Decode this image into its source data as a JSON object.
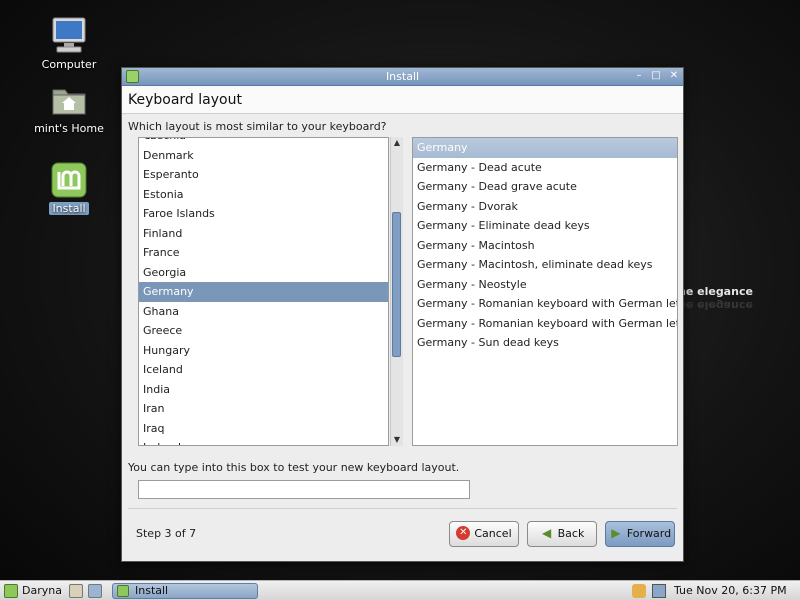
{
  "desktop": {
    "icons": [
      {
        "label": "Computer"
      },
      {
        "label": "mint's Home"
      },
      {
        "label": "Install"
      }
    ],
    "backdrop_text": "he elegance"
  },
  "window": {
    "title": "Install",
    "controls": {
      "minimize": "–",
      "maximize": "□",
      "close": "✕"
    },
    "header": "Keyboard layout",
    "prompt": "Which layout is most similar to your keyboard?",
    "layouts": {
      "partial_top": "Czechia",
      "items": [
        "Denmark",
        "Esperanto",
        "Estonia",
        "Faroe Islands",
        "Finland",
        "France",
        "Georgia",
        "Germany",
        "Ghana",
        "Greece",
        "Hungary",
        "Iceland",
        "India",
        "Iran",
        "Iraq"
      ],
      "partial_bottom": "Ireland",
      "selected": "Germany"
    },
    "variants": {
      "items": [
        "Germany",
        "Germany - Dead acute",
        "Germany - Dead grave acute",
        "Germany - Dvorak",
        "Germany - Eliminate dead keys",
        "Germany - Macintosh",
        "Germany - Macintosh, eliminate dead keys",
        "Germany - Neostyle",
        "Germany - Romanian keyboard with German letters",
        "Germany - Romanian keyboard with German letters,",
        "Germany - Sun dead keys"
      ],
      "selected": "Germany"
    },
    "test_label": "You can type into this box to test your new keyboard layout.",
    "test_value": "",
    "step": "Step 3 of 7",
    "buttons": {
      "cancel": "Cancel",
      "back": "Back",
      "forward": "Forward"
    }
  },
  "taskbar": {
    "menu_label": "Daryna",
    "task_label": "Install",
    "clock": "Tue Nov 20,  6:37 PM"
  },
  "colors": {
    "selection": "#7a96b8",
    "titlebar": "#86a2c5",
    "mint_green": "#8ec85c"
  }
}
